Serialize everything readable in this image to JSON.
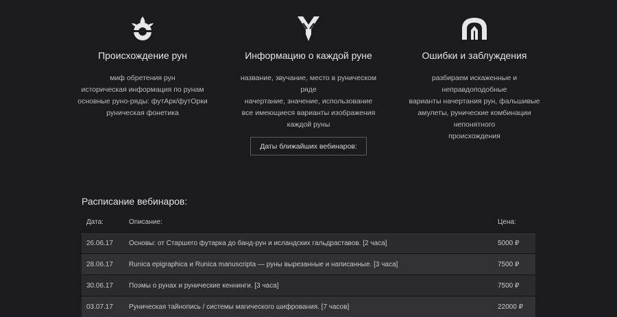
{
  "features": [
    {
      "icon": "rune-origin-icon",
      "title": "Происхождение рун",
      "items": [
        "миф обретения рун",
        "историческая информация по рунам",
        "основные руно-ряды: футАрк/футОрки",
        "руническая фонетика"
      ]
    },
    {
      "icon": "rune-info-icon",
      "title": "Информацию о каждой руне",
      "items": [
        "название, звучание, место в руническом ряде",
        "начертание, значение, использование",
        "все имеющиеся варианты изображения",
        "каждой руны"
      ]
    },
    {
      "icon": "rune-errors-icon",
      "title": "Ошибки и заблуждения",
      "items": [
        "разбираем искаженные и неправдоподобные",
        "варианты начертания рун, фальшивые",
        "амулеты, рунические комбинации непонятного",
        "происхождения"
      ]
    }
  ],
  "cta": {
    "label": "Даты ближайших вебинаров:"
  },
  "schedule": {
    "title": "Расписание вебинаров:",
    "headers": {
      "date": "Дата:",
      "description": "Описание:",
      "price": "Цена:"
    },
    "rows": [
      {
        "date": "26.06.17",
        "description": "Основы: от Старшего футарка до банд-рун и исландских гальдраставов. [2 часа]",
        "price": "5000 ₽"
      },
      {
        "date": "28.06.17",
        "description": "Runica epigraphica и Runica manuscripta — руны вырезанные и написанные. [3 часа]",
        "price": "7500 ₽"
      },
      {
        "date": "30.06.17",
        "description": "Поэмы о рунах и рунические кеннинги. [3 часа]",
        "price": "7500 ₽"
      },
      {
        "date": "03.07.17",
        "description": "Руническая тайнопись / системы магического шифрования. [7 часов]",
        "price": "22000 ₽"
      }
    ]
  }
}
